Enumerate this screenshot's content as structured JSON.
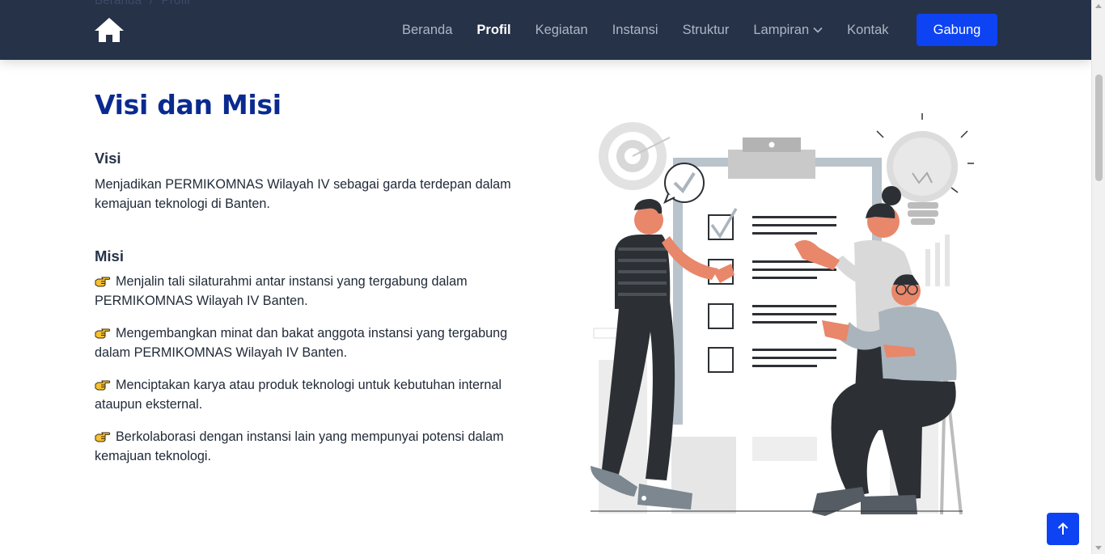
{
  "breadcrumb": {
    "home": "Beranda",
    "separator": "/",
    "current": "Profil"
  },
  "logo": {
    "icon": "home-icon"
  },
  "nav": {
    "items": [
      {
        "label": "Beranda",
        "active": false
      },
      {
        "label": "Profil",
        "active": true
      },
      {
        "label": "Kegiatan",
        "active": false
      },
      {
        "label": "Instansi",
        "active": false
      },
      {
        "label": "Struktur",
        "active": false
      },
      {
        "label": "Lampiran",
        "active": false,
        "dropdown": true
      },
      {
        "label": "Kontak",
        "active": false
      }
    ],
    "cta_label": "Gabung"
  },
  "main": {
    "title": "Visi dan Misi",
    "visi": {
      "heading": "Visi",
      "text": "Menjadikan PERMIKOMNAS Wilayah IV sebagai garda terdepan dalam kemajuan teknologi di Banten."
    },
    "misi": {
      "heading": "Misi",
      "items": [
        "Menjalin tali silaturahmi antar instansi yang tergabung dalam PERMIKOMNAS Wilayah IV Banten.",
        "Mengembangkan minat dan bakat anggota instansi yang tergabung dalam PERMIKOMNAS Wilayah IV Banten.",
        "Menciptakan karya atau produk teknologi untuk kebutuhan internal ataupun eksternal.",
        "Berkolaborasi dengan instansi lain yang mempunyai potensi dalam kemajuan teknologi."
      ],
      "bullet_icon": "pointing-hand-icon"
    }
  },
  "colors": {
    "navbar": "#263248",
    "accent": "#0d43f3",
    "title": "#0a2a8f",
    "illustration_skin": "#e8876a"
  }
}
